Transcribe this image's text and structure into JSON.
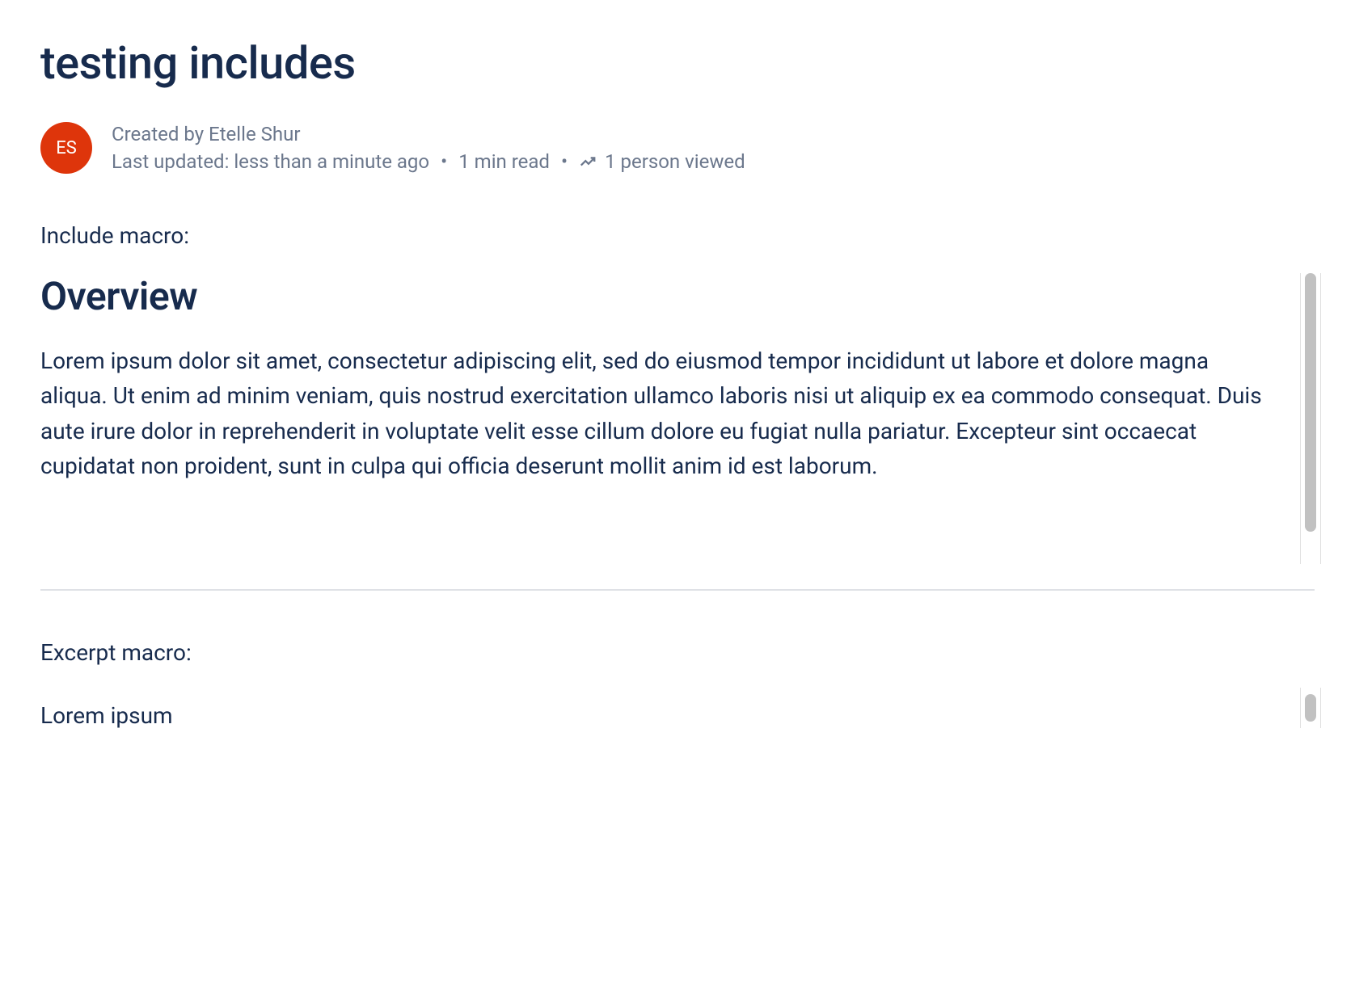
{
  "page": {
    "title": "testing includes"
  },
  "byline": {
    "avatar_initials": "ES",
    "created_by_prefix": "Created by ",
    "author_name": "Etelle Shur",
    "last_updated": "Last updated: less than a minute ago",
    "read_time": "1 min read",
    "views": "1 person viewed"
  },
  "content": {
    "include_label": "Include macro:",
    "overview_heading": "Overview",
    "overview_text": "Lorem ipsum dolor sit amet, consectetur adipiscing elit, sed do eiusmod tempor incididunt ut labore et dolore magna aliqua. Ut enim ad minim veniam, quis nostrud exercitation ullamco laboris nisi ut aliquip ex ea commodo consequat. Duis aute irure dolor in reprehenderit in voluptate velit esse cillum dolore eu fugiat nulla pariatur. Excepteur sint occaecat cupidatat non proident, sunt in culpa qui officia deserunt mollit anim id est laborum.",
    "excerpt_label": "Excerpt macro:",
    "excerpt_text": "Lorem ipsum"
  }
}
